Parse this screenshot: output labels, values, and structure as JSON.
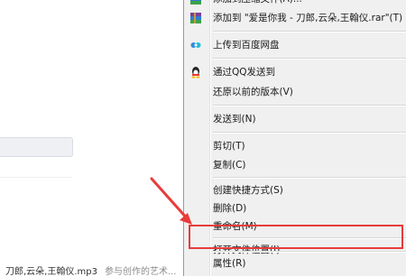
{
  "menu": {
    "items": [
      {
        "label": "添加到压缩文件(A)...",
        "icon": "winrar-icon"
      },
      {
        "label": "添加到 \"爱是你我 - 刀郎,云朵,王翰仪.rar\"(T)",
        "icon": "winrar-icon"
      },
      {
        "label": "上传到百度网盘",
        "icon": "baidu-netdisk-icon"
      },
      {
        "label": "通过QQ发送到",
        "icon": "qq-icon"
      },
      {
        "label": "还原以前的版本(V)",
        "icon": ""
      },
      {
        "label": "发送到(N)",
        "icon": ""
      },
      {
        "label": "剪切(T)",
        "icon": ""
      },
      {
        "label": "复制(C)",
        "icon": ""
      },
      {
        "label": "创建快捷方式(S)",
        "icon": ""
      },
      {
        "label": "删除(D)",
        "icon": ""
      },
      {
        "label": "重命名(M)",
        "icon": ""
      },
      {
        "label": "打开文件位置(I)",
        "icon": ""
      },
      {
        "label": "属性(R)",
        "icon": ""
      }
    ]
  },
  "file_list": {
    "name": "刀郎,云朵,王翰仪.mp3",
    "sub": "参与创作的艺术..."
  },
  "colors": {
    "menu_bg": "#f0f0f0",
    "highlight_border": "#e83b3b",
    "arrow": "#e83b3b"
  }
}
